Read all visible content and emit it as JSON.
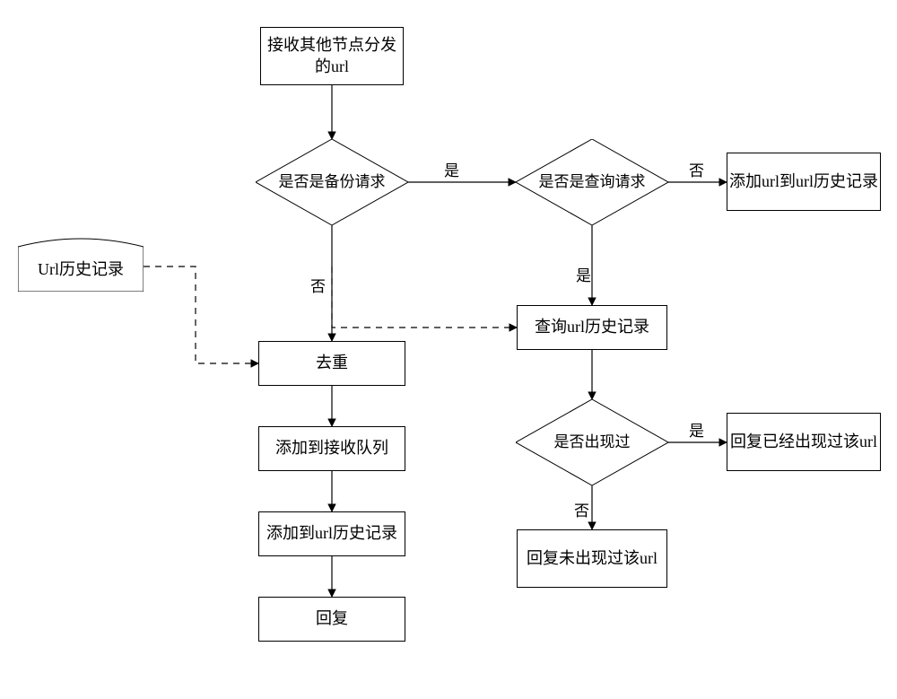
{
  "nodes": {
    "receive": "接收其他节点分发的url",
    "isBackup": "是否是备份请求",
    "isQuery": "是否是查询请求",
    "addHistory": "添加url到url历史记录",
    "urlHistory": "Url历史记录",
    "dedup": "去重",
    "addQueue": "添加到接收队列",
    "addUrlHistory": "添加到url历史记录",
    "reply": "回复",
    "queryHistory": "查询url历史记录",
    "appeared": "是否出现过",
    "replyAppeared": "回复已经出现过该url",
    "replyNotAppeared": "回复未出现过该url"
  },
  "labels": {
    "yes": "是",
    "no": "否"
  },
  "chart_data": {
    "type": "flowchart",
    "title": "",
    "nodes": [
      {
        "id": "receive",
        "type": "process",
        "text": "接收其他节点分发的url"
      },
      {
        "id": "isBackup",
        "type": "decision",
        "text": "是否是备份请求"
      },
      {
        "id": "isQuery",
        "type": "decision",
        "text": "是否是查询请求"
      },
      {
        "id": "addHistory",
        "type": "process",
        "text": "添加url到url历史记录"
      },
      {
        "id": "urlHistory",
        "type": "datastore",
        "text": "Url历史记录"
      },
      {
        "id": "dedup",
        "type": "process",
        "text": "去重"
      },
      {
        "id": "addQueue",
        "type": "process",
        "text": "添加到接收队列"
      },
      {
        "id": "addUrlHistory",
        "type": "process",
        "text": "添加到url历史记录"
      },
      {
        "id": "reply",
        "type": "process",
        "text": "回复"
      },
      {
        "id": "queryHistory",
        "type": "process",
        "text": "查询url历史记录"
      },
      {
        "id": "appeared",
        "type": "decision",
        "text": "是否出现过"
      },
      {
        "id": "replyAppeared",
        "type": "process",
        "text": "回复已经出现过该url"
      },
      {
        "id": "replyNotAppeared",
        "type": "process",
        "text": "回复未出现过该url"
      }
    ],
    "edges": [
      {
        "from": "receive",
        "to": "isBackup",
        "style": "solid"
      },
      {
        "from": "isBackup",
        "to": "isQuery",
        "label": "是",
        "style": "solid"
      },
      {
        "from": "isBackup",
        "to": "dedup",
        "label": "否",
        "style": "solid"
      },
      {
        "from": "isQuery",
        "to": "addHistory",
        "label": "否",
        "style": "solid"
      },
      {
        "from": "isQuery",
        "to": "queryHistory",
        "label": "是",
        "style": "solid"
      },
      {
        "from": "urlHistory",
        "to": "dedup",
        "style": "dashed"
      },
      {
        "from": "urlHistory",
        "to": "queryHistory",
        "style": "dashed"
      },
      {
        "from": "dedup",
        "to": "addQueue",
        "style": "solid"
      },
      {
        "from": "addQueue",
        "to": "addUrlHistory",
        "style": "solid"
      },
      {
        "from": "addUrlHistory",
        "to": "reply",
        "style": "solid"
      },
      {
        "from": "queryHistory",
        "to": "appeared",
        "style": "solid"
      },
      {
        "from": "appeared",
        "to": "replyAppeared",
        "label": "是",
        "style": "solid"
      },
      {
        "from": "appeared",
        "to": "replyNotAppeared",
        "label": "否",
        "style": "solid"
      }
    ]
  }
}
